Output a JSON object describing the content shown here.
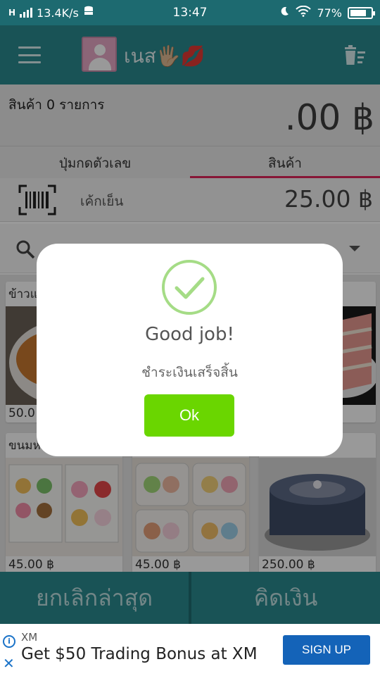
{
  "status_bar": {
    "network_speed": "13.4K/s",
    "time": "13:47",
    "battery_percent": "77%",
    "battery_level": 0.77
  },
  "app_bar": {
    "user_name": "เนส🖐🏼💋"
  },
  "summary": {
    "item_count_text": "สินค้า 0 รายการ",
    "total_text": ".00 ฿"
  },
  "tabs": [
    {
      "label": "ปุ่มกดตัวเลข",
      "active": false
    },
    {
      "label": "สินค้า",
      "active": true
    }
  ],
  "barcode_row": {
    "item_name": "เค้กเย็น",
    "item_price": "25.00 ฿"
  },
  "products": [
    {
      "name": "ข้าวแ",
      "price": "50.0"
    },
    {
      "name": "",
      "price": ""
    },
    {
      "name": "",
      "price": ""
    },
    {
      "name": "ขนมห",
      "price": "45.00 ฿"
    },
    {
      "name": "",
      "price": "45.00 ฿"
    },
    {
      "name": "",
      "price": "250.00 ฿"
    }
  ],
  "bottom": {
    "cancel_label": "ยกเลิกล่าสุด",
    "checkout_label": "คิดเงิน"
  },
  "ad": {
    "brand": "XM",
    "headline": "Get $50 Trading Bonus at XM",
    "cta": "SIGN UP",
    "info_glyph": "i",
    "close_glyph": "✕"
  },
  "modal": {
    "title": "Good job!",
    "text": "ชำระเงินเสร็จสิ้น",
    "ok_label": "Ok"
  },
  "colors": {
    "primary": "#2a8a90",
    "status_bar": "#1d6a70",
    "tab_indicator": "#e2265a",
    "ok_button": "#6ad600",
    "success_ring": "#a5dc86",
    "ad_cta": "#1463b8"
  }
}
